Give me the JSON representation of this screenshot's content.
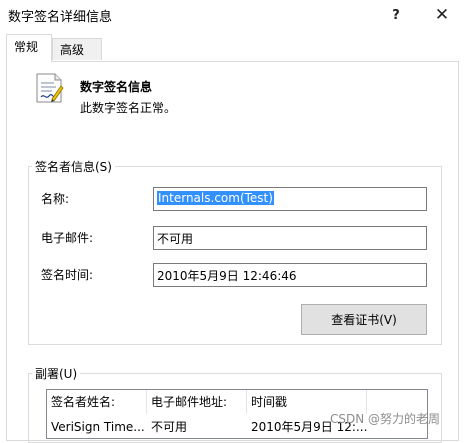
{
  "window": {
    "title": "数字签名详细信息",
    "help_label": "?",
    "close_label": "✕"
  },
  "tabs": [
    {
      "label": "常规",
      "active": true
    },
    {
      "label": "高级",
      "active": false
    }
  ],
  "info": {
    "icon": "certificate-icon",
    "title": "数字签名信息",
    "status": "此数字签名正常。"
  },
  "signer": {
    "legend": "签名者信息(S)",
    "name_label": "名称:",
    "name_value": "Internals.com(Test)",
    "email_label": "电子邮件:",
    "email_value": "不可用",
    "time_label": "签名时间:",
    "time_value": "2010年5月9日 12:46:46",
    "view_button": "查看证书(V)"
  },
  "countersignatures": {
    "legend": "副署(U)",
    "columns": [
      "签名者姓名:",
      "电子邮件地址:",
      "时间戳"
    ],
    "rows": [
      [
        "VeriSign Time...",
        "不可用",
        "2010年5月9日 12:..."
      ]
    ]
  },
  "watermark": "CSDN @努力的老周"
}
